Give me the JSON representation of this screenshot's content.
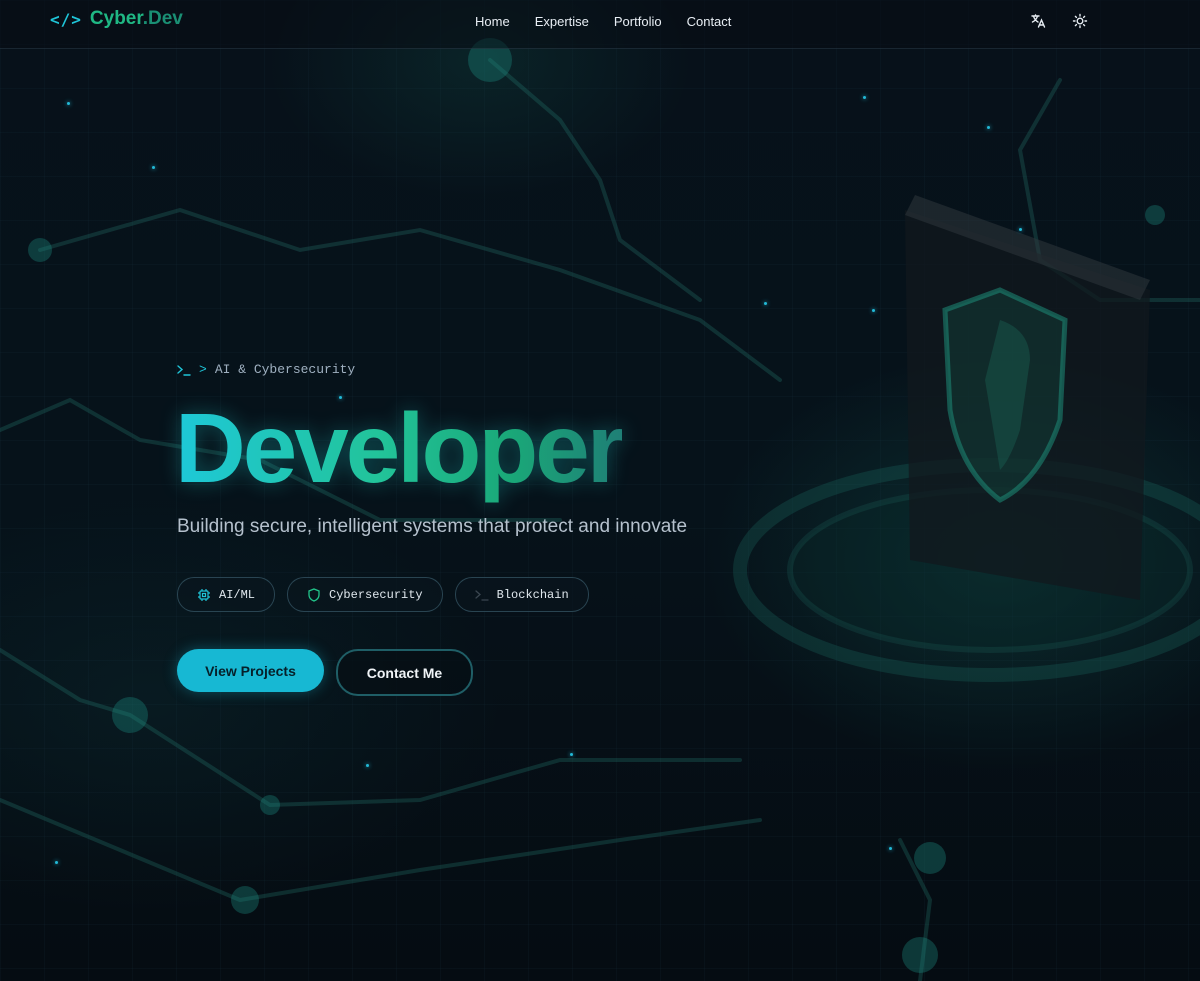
{
  "nav": {
    "logo_icon": "</>",
    "logo_part1": "Cyber",
    "logo_part2": ".Dev",
    "links": [
      "Home",
      "Expertise",
      "Portfolio",
      "Contact"
    ],
    "tools": [
      "translate-icon",
      "sun-icon"
    ]
  },
  "hero": {
    "tagline_prefix": ">",
    "tagline": "AI & Cybersecurity",
    "title": "Developer",
    "subtitle": "Building secure, intelligent systems that protect and innovate",
    "chips": [
      {
        "label": "AI/ML",
        "icon": "cpu-icon"
      },
      {
        "label": "Cybersecurity",
        "icon": "shield-icon"
      },
      {
        "label": "Blockchain",
        "icon": "terminal-icon"
      }
    ],
    "primary_button": "View Projects",
    "secondary_button": "Contact Me"
  },
  "colors": {
    "accent_cyan": "#17b8d3",
    "accent_green": "#1fb884",
    "background": "#070d14"
  }
}
